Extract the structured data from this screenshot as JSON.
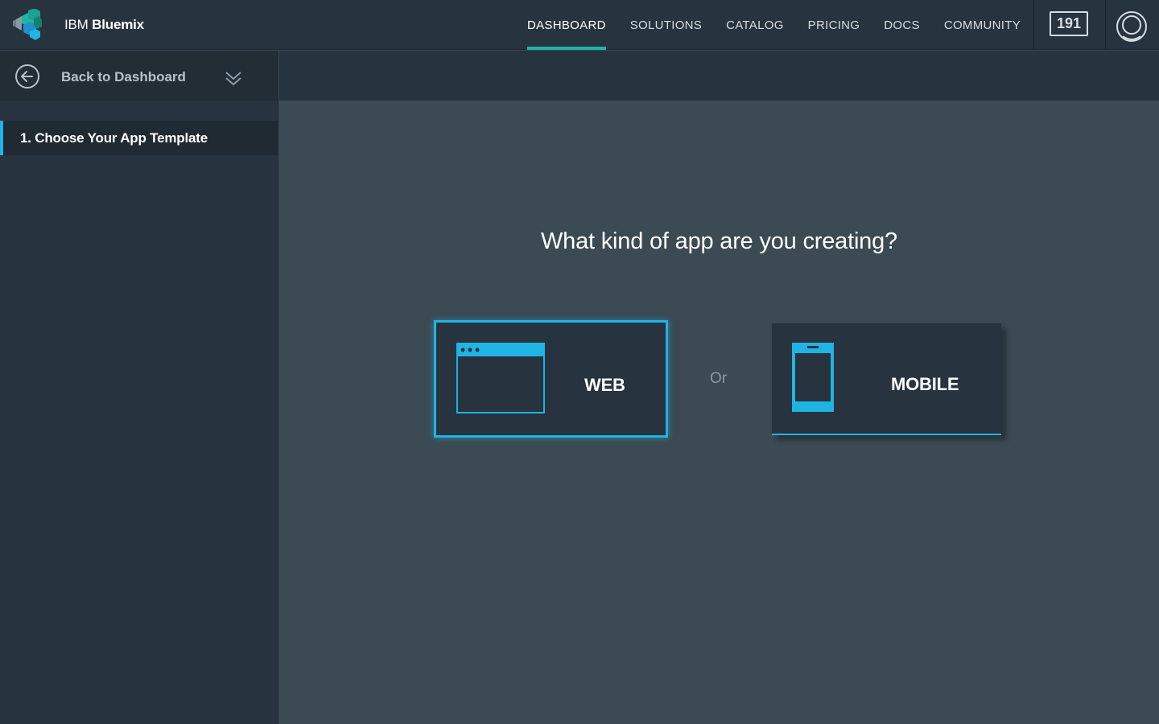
{
  "header": {
    "brand_prefix": "IBM",
    "brand_name": "Bluemix",
    "nav": [
      {
        "label": "DASHBOARD",
        "active": true
      },
      {
        "label": "SOLUTIONS",
        "active": false
      },
      {
        "label": "CATALOG",
        "active": false
      },
      {
        "label": "PRICING",
        "active": false
      },
      {
        "label": "DOCS",
        "active": false
      },
      {
        "label": "COMMUNITY",
        "active": false
      }
    ],
    "counter": "191",
    "icons": {
      "logo": "bluemix-logo-icon",
      "account": "user-avatar-icon"
    }
  },
  "sidebar": {
    "back_label": "Back to Dashboard",
    "back_icon": "arrow-left-circle-icon",
    "expand_icon": "chevron-down-icon",
    "steps": [
      {
        "label": "1. Choose Your App Template",
        "active": true
      }
    ]
  },
  "main": {
    "question": "What kind of app are you creating?",
    "or_label": "Or",
    "options": [
      {
        "label": "WEB",
        "icon": "browser-window-icon",
        "selected": true
      },
      {
        "label": "MOBILE",
        "icon": "mobile-phone-icon",
        "selected": false
      }
    ]
  },
  "colors": {
    "accent_blue": "#1fb4e3",
    "accent_teal": "#1fb4a3",
    "panel": "#27333e",
    "canvas": "#3b4a53"
  }
}
